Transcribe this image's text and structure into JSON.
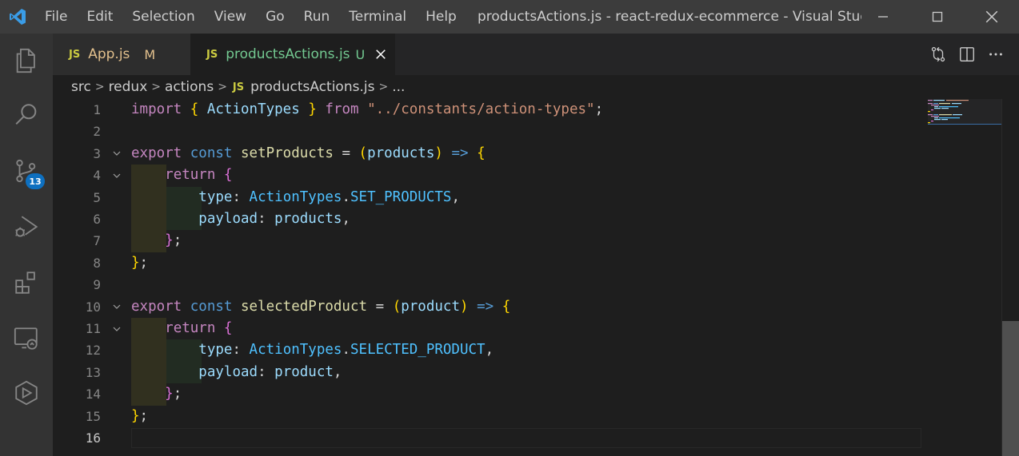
{
  "menu": [
    "File",
    "Edit",
    "Selection",
    "View",
    "Go",
    "Run",
    "Terminal",
    "Help"
  ],
  "window_title": "productsActions.js - react-redux-ecommerce - Visual Studio ...",
  "activity": {
    "scm_badge": "13"
  },
  "tabs": [
    {
      "lang": "JS",
      "name": "App.js",
      "status": "M"
    },
    {
      "lang": "JS",
      "name": "productsActions.js",
      "status": "U"
    }
  ],
  "breadcrumb": {
    "src": "src",
    "redux": "redux",
    "actions": "actions",
    "lang": "JS",
    "file": "productsActions.js",
    "more": "..."
  },
  "code": {
    "l1": {
      "import": "import",
      "open": "{",
      "name": "ActionTypes",
      "close": "}",
      "from": "from",
      "path": "\"../constants/action-types\"",
      "semi": ";"
    },
    "l3": {
      "export": "export",
      "const": "const",
      "name": "setProducts",
      "eq": "=",
      "po": "(",
      "param": "products",
      "pc": ")",
      "arrow": "=>",
      "brace": "{"
    },
    "l4": {
      "return": "return",
      "brace": "{"
    },
    "l5": {
      "key": "type",
      "colon": ":",
      "obj": "ActionTypes",
      "dot": ".",
      "prop": "SET_PRODUCTS",
      "comma": ","
    },
    "l6": {
      "key": "payload",
      "colon": ":",
      "value": "products",
      "comma": ","
    },
    "l7": {
      "brace": "}",
      "semi": ";"
    },
    "l8": {
      "brace": "}",
      "semi": ";"
    },
    "l10": {
      "export": "export",
      "const": "const",
      "name": "selectedProduct",
      "eq": "=",
      "po": "(",
      "param": "product",
      "pc": ")",
      "arrow": "=>",
      "brace": "{"
    },
    "l11": {
      "return": "return",
      "brace": "{"
    },
    "l12": {
      "key": "type",
      "colon": ":",
      "obj": "ActionTypes",
      "dot": ".",
      "prop": "SELECTED_PRODUCT",
      "comma": ","
    },
    "l13": {
      "key": "payload",
      "colon": ":",
      "value": "product",
      "comma": ","
    },
    "l14": {
      "brace": "}",
      "semi": ";"
    },
    "l15": {
      "brace": "}",
      "semi": ";"
    }
  },
  "line_numbers": [
    "1",
    "2",
    "3",
    "4",
    "5",
    "6",
    "7",
    "8",
    "9",
    "10",
    "11",
    "12",
    "13",
    "14",
    "15",
    "16"
  ],
  "colors": {
    "accent": "#0e70c0",
    "titlebar": "#3c3c3c",
    "editor_bg": "#1e1e1e"
  }
}
